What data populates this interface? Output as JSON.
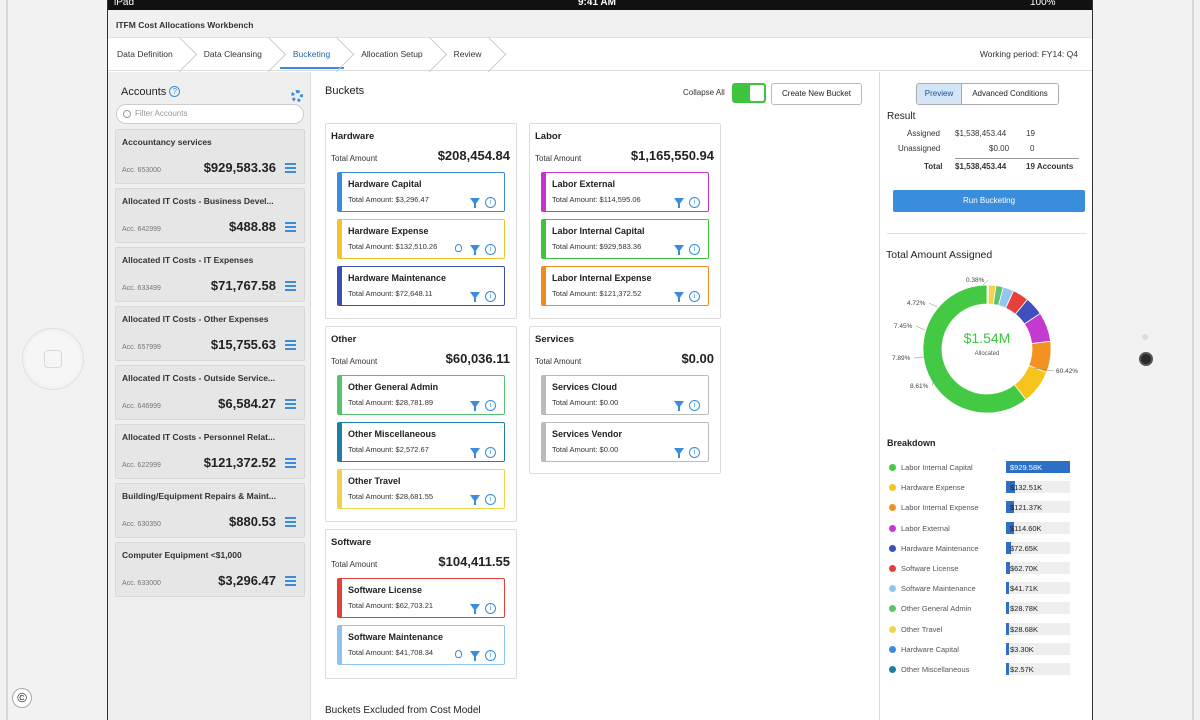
{
  "device": {
    "carrier": "iPad",
    "time": "9:41 AM",
    "battery": "100%",
    "copyright": "©"
  },
  "app": {
    "title": "ITFM Cost Allocations Workbench",
    "steps": [
      "Data Definition",
      "Data Cleansing",
      "Bucketing",
      "Allocation Setup",
      "Review"
    ],
    "active_step": "Bucketing",
    "working_period_label": "Working period:",
    "working_period_value": "FY14: Q4"
  },
  "accounts": {
    "title": "Accounts",
    "filter_placeholder": "Filter Accounts",
    "items": [
      {
        "name": "Accountancy services",
        "number": "Acc. 653000",
        "amount": "$929,583.36"
      },
      {
        "name": "Allocated IT Costs - Business Devel...",
        "number": "Acc. 642999",
        "amount": "$488.88"
      },
      {
        "name": "Allocated IT Costs - IT Expenses",
        "number": "Acc. 633499",
        "amount": "$71,767.58"
      },
      {
        "name": "Allocated IT Costs - Other Expenses",
        "number": "Acc. 657999",
        "amount": "$15,755.63"
      },
      {
        "name": "Allocated IT Costs - Outside Service...",
        "number": "Acc. 646999",
        "amount": "$6,584.27"
      },
      {
        "name": "Allocated IT Costs - Personnel Relat...",
        "number": "Acc. 622999",
        "amount": "$121,372.52"
      },
      {
        "name": "Building/Equipment Repairs & Maint...",
        "number": "Acc. 630350",
        "amount": "$880.53"
      },
      {
        "name": "Computer Equipment <$1,000",
        "number": "Acc. 633000",
        "amount": "$3,296.47"
      }
    ]
  },
  "buckets": {
    "title": "Buckets",
    "collapse_label": "Collapse All",
    "new_bucket_label": "Create New Bucket",
    "total_label": "Total Amount",
    "excluded_label": "Buckets Excluded from Cost Model",
    "groups": [
      {
        "title": "Hardware",
        "total": "$208,454.84",
        "subs": [
          {
            "name": "Hardware Capital",
            "amount": "Total Amount: $3,296.47",
            "color": "#3a8ddc"
          },
          {
            "name": "Hardware Expense",
            "amount": "Total Amount: $132,510.26",
            "color": "#f3c32b"
          },
          {
            "name": "Hardware Maintenance",
            "amount": "Total Amount: $72,648.11",
            "color": "#3c4db8"
          }
        ]
      },
      {
        "title": "Labor",
        "total": "$1,165,550.94",
        "subs": [
          {
            "name": "Labor External",
            "amount": "Total Amount: $114,595.06",
            "color": "#c832d4"
          },
          {
            "name": "Labor Internal Capital",
            "amount": "Total Amount: $929,583.36",
            "color": "#3ec43e"
          },
          {
            "name": "Labor Internal Expense",
            "amount": "Total Amount: $121,372.52",
            "color": "#f08b1d"
          }
        ]
      },
      {
        "title": "Other",
        "total": "$60,036.11",
        "subs": [
          {
            "name": "Other General Admin",
            "amount": "Total Amount: $28,781.89",
            "color": "#55c46a"
          },
          {
            "name": "Other Miscellaneous",
            "amount": "Total Amount: $2,572.67",
            "color": "#1e7fa8"
          },
          {
            "name": "Other Travel",
            "amount": "Total Amount: $28,681.55",
            "color": "#f3d24a"
          }
        ]
      },
      {
        "title": "Services",
        "total": "$0.00",
        "subs": [
          {
            "name": "Services Cloud",
            "amount": "Total Amount: $0.00",
            "color": "#bbbbbb"
          },
          {
            "name": "Services Vendor",
            "amount": "Total Amount: $0.00",
            "color": "#bbbbbb"
          }
        ]
      },
      {
        "title": "Software",
        "total": "$104,411.55",
        "subs": [
          {
            "name": "Software License",
            "amount": "Total Amount: $62,703.21",
            "color": "#e2413a"
          },
          {
            "name": "Software Maintenance",
            "amount": "Total Amount: $41,708.34",
            "color": "#8fc3ef"
          }
        ]
      }
    ]
  },
  "result": {
    "tab_preview": "Preview",
    "tab_advanced": "Advanced Conditions",
    "title": "Result",
    "assigned_label": "Assigned",
    "assigned_amount": "$1,538,453.44",
    "assigned_count": "19",
    "unassigned_label": "Unassigned",
    "unassigned_amount": "$0.00",
    "unassigned_count": "0",
    "total_label": "Total",
    "total_amount": "$1,538,453.44",
    "total_count": "19 Accounts",
    "run_label": "Run Bucketing",
    "chart_title": "Total Amount Assigned",
    "center_value": "$1.54M",
    "center_label": "Allocated",
    "breakdown_title": "Breakdown"
  },
  "chart_data": {
    "type": "pie",
    "title": "Total Amount Assigned",
    "slices": [
      {
        "label": "Labor Internal Capital",
        "value": 60.42,
        "color": "#44c944"
      },
      {
        "label": "Hardware Expense",
        "value": 8.61,
        "color": "#f5c51d"
      },
      {
        "label": "Labor Internal Expense",
        "value": 7.89,
        "color": "#f39221"
      },
      {
        "label": "Labor External",
        "value": 7.45,
        "color": "#c43ad0"
      },
      {
        "label": "Hardware Maintenance",
        "value": 4.72,
        "color": "#3f4fbd"
      },
      {
        "label": "Software License",
        "value": 4.08,
        "color": "#e5413a"
      },
      {
        "label": "Software Maintenance",
        "value": 2.71,
        "color": "#92c5f0"
      },
      {
        "label": "Other General Admin",
        "value": 1.87,
        "color": "#5cc46e"
      },
      {
        "label": "Other Travel",
        "value": 1.86,
        "color": "#f1d34c"
      },
      {
        "label": "Hardware Capital",
        "value": 0.21,
        "color": "#3a8ddc"
      },
      {
        "label": "Other Miscellaneous",
        "value": 0.17,
        "color": "#1d7ea6"
      }
    ],
    "labels_shown": [
      "60.42%",
      "8.61%",
      "7.89%",
      "7.45%",
      "4.72%",
      "0.38%"
    ],
    "breakdown": [
      {
        "label": "Labor Internal Capital",
        "value": "$929.58K",
        "amount_k": 929.58,
        "color": "#44c944"
      },
      {
        "label": "Hardware Expense",
        "value": "$132.51K",
        "amount_k": 132.51,
        "color": "#f5c51d"
      },
      {
        "label": "Labor Internal Expense",
        "value": "$121.37K",
        "amount_k": 121.37,
        "color": "#f39221"
      },
      {
        "label": "Labor External",
        "value": "$114.60K",
        "amount_k": 114.6,
        "color": "#c43ad0"
      },
      {
        "label": "Hardware Maintenance",
        "value": "$72.65K",
        "amount_k": 72.65,
        "color": "#3f4fbd"
      },
      {
        "label": "Software License",
        "value": "$62.70K",
        "amount_k": 62.7,
        "color": "#e5413a"
      },
      {
        "label": "Software Maintenance",
        "value": "$41.71K",
        "amount_k": 41.71,
        "color": "#92c5f0"
      },
      {
        "label": "Other General Admin",
        "value": "$28.78K",
        "amount_k": 28.78,
        "color": "#5cc46e"
      },
      {
        "label": "Other Travel",
        "value": "$28.68K",
        "amount_k": 28.68,
        "color": "#f1d34c"
      },
      {
        "label": "Hardware Capital",
        "value": "$3.30K",
        "amount_k": 3.3,
        "color": "#3a8ddc"
      },
      {
        "label": "Other Miscellaneous",
        "value": "$2.57K",
        "amount_k": 2.57,
        "color": "#1d7ea6"
      }
    ]
  }
}
